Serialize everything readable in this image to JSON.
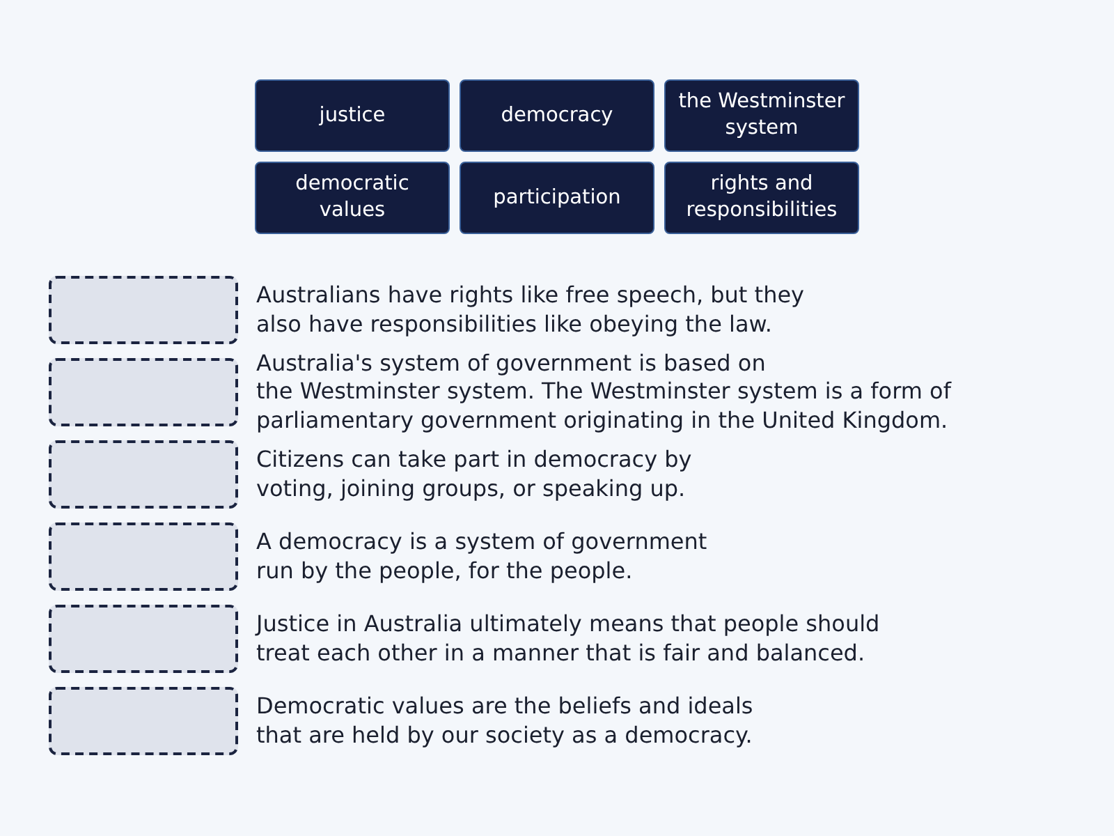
{
  "tiles": [
    {
      "label": "justice"
    },
    {
      "label": "democracy"
    },
    {
      "label": "the Westminster system"
    },
    {
      "label": "democratic values"
    },
    {
      "label": "participation"
    },
    {
      "label": "rights and responsibilities"
    }
  ],
  "statements": [
    {
      "text": "Australians have rights like free speech, but they\nalso have responsibilities like obeying the law."
    },
    {
      "text": "Australia's system of government is based on\nthe Westminster system. The Westminster system is a form of\nparliamentary government originating in the United Kingdom."
    },
    {
      "text": "Citizens can take part in democracy by\nvoting, joining groups, or speaking up."
    },
    {
      "text": "A democracy is a system of government\nrun by the people, for the people."
    },
    {
      "text": "Justice in Australia ultimately means that people should\ntreat each other in a manner that is fair and balanced."
    },
    {
      "text": "Democratic values are the beliefs and ideals\nthat are held by our society as a democracy."
    }
  ]
}
